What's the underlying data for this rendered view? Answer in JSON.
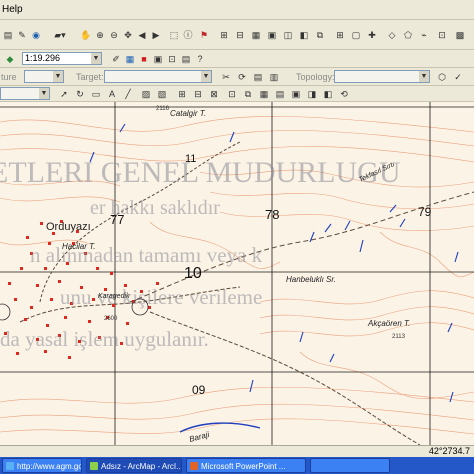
{
  "menubar": {
    "help_label": "Help"
  },
  "toolbar": {
    "scale_value": "1:19.296",
    "task_label": "ture",
    "target_label": "Target:",
    "topology_label": "Topology:"
  },
  "map": {
    "watermark_lines": [
      "ETLERI GENEL MUDURLUGU",
      "er hakkı saklıdır",
      "n alınmadan tamamı veya k",
      "unu ve kişilere verileme",
      "da yasal işlem uygulanır."
    ],
    "place_names": [
      "Catalgir T.",
      "Orduyazı",
      "Hacilar T.",
      "Hanbeluklı Sr.",
      "Akçaören T.",
      "Tekfasıl Sırtı",
      "Karagedik",
      "Baraji"
    ],
    "grid_numbers": [
      "11",
      "77",
      "78",
      "79",
      "10",
      "09"
    ],
    "spot_heights": [
      "2116",
      "2113",
      "2600"
    ]
  },
  "status": {
    "coords": "42°2734.7"
  },
  "taskbar": {
    "items": [
      {
        "label": "http://www.agm.gov...",
        "icon": "internet-explorer-icon"
      },
      {
        "label": "Adsız - ArcMap - ArcI...",
        "icon": "arcmap-icon"
      },
      {
        "label": "Microsoft PowerPoint ...",
        "icon": "powerpoint-icon"
      }
    ]
  },
  "colors": {
    "map_background": "#fbf3e6",
    "contour": "#e8926a",
    "settlement": "#e0281e",
    "grid": "#1a1a1a",
    "water": "#1f3fbf",
    "taskbar": "#2458c8"
  }
}
